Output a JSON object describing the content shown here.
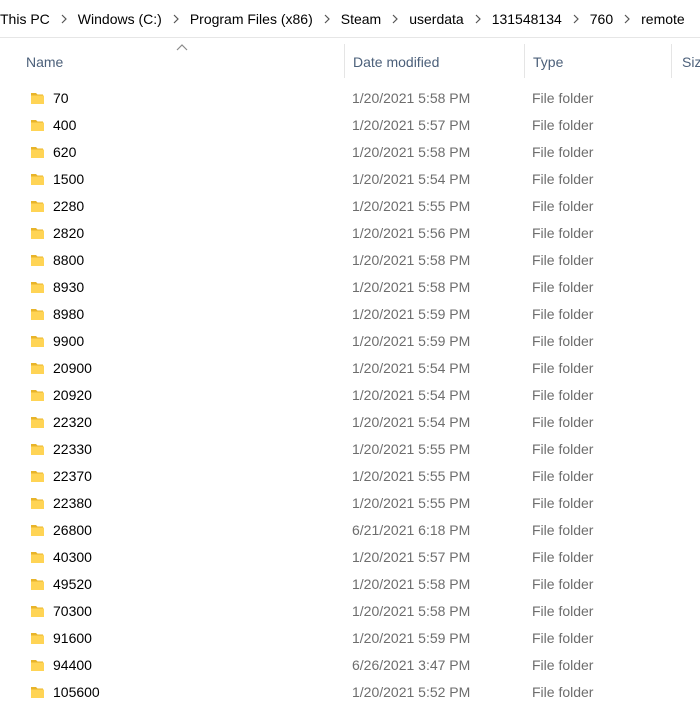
{
  "breadcrumb": [
    "This PC",
    "Windows (C:)",
    "Program Files (x86)",
    "Steam",
    "userdata",
    "131548134",
    "760",
    "remote"
  ],
  "columns": {
    "name": "Name",
    "date_modified": "Date modified",
    "type": "Type",
    "size": "Siz"
  },
  "sort": {
    "column": "name",
    "direction": "ascending"
  },
  "files": [
    {
      "name": "70",
      "date": "1/20/2021 5:58 PM",
      "type": "File folder"
    },
    {
      "name": "400",
      "date": "1/20/2021 5:57 PM",
      "type": "File folder"
    },
    {
      "name": "620",
      "date": "1/20/2021 5:58 PM",
      "type": "File folder"
    },
    {
      "name": "1500",
      "date": "1/20/2021 5:54 PM",
      "type": "File folder"
    },
    {
      "name": "2280",
      "date": "1/20/2021 5:55 PM",
      "type": "File folder"
    },
    {
      "name": "2820",
      "date": "1/20/2021 5:56 PM",
      "type": "File folder"
    },
    {
      "name": "8800",
      "date": "1/20/2021 5:58 PM",
      "type": "File folder"
    },
    {
      "name": "8930",
      "date": "1/20/2021 5:58 PM",
      "type": "File folder"
    },
    {
      "name": "8980",
      "date": "1/20/2021 5:59 PM",
      "type": "File folder"
    },
    {
      "name": "9900",
      "date": "1/20/2021 5:59 PM",
      "type": "File folder"
    },
    {
      "name": "20900",
      "date": "1/20/2021 5:54 PM",
      "type": "File folder"
    },
    {
      "name": "20920",
      "date": "1/20/2021 5:54 PM",
      "type": "File folder"
    },
    {
      "name": "22320",
      "date": "1/20/2021 5:54 PM",
      "type": "File folder"
    },
    {
      "name": "22330",
      "date": "1/20/2021 5:55 PM",
      "type": "File folder"
    },
    {
      "name": "22370",
      "date": "1/20/2021 5:55 PM",
      "type": "File folder"
    },
    {
      "name": "22380",
      "date": "1/20/2021 5:55 PM",
      "type": "File folder"
    },
    {
      "name": "26800",
      "date": "6/21/2021 6:18 PM",
      "type": "File folder"
    },
    {
      "name": "40300",
      "date": "1/20/2021 5:57 PM",
      "type": "File folder"
    },
    {
      "name": "49520",
      "date": "1/20/2021 5:58 PM",
      "type": "File folder"
    },
    {
      "name": "70300",
      "date": "1/20/2021 5:58 PM",
      "type": "File folder"
    },
    {
      "name": "91600",
      "date": "1/20/2021 5:59 PM",
      "type": "File folder"
    },
    {
      "name": "94400",
      "date": "6/26/2021 3:47 PM",
      "type": "File folder"
    },
    {
      "name": "105600",
      "date": "1/20/2021 5:52 PM",
      "type": "File folder"
    }
  ],
  "icons": {
    "folder": "folder-icon",
    "separator": "chevron-right-icon",
    "sort": "sort-ascending-icon"
  },
  "colors": {
    "folder_fill": "#ffd455",
    "folder_back": "#e8b42a",
    "header_text": "#4c607a",
    "secondary_text": "#6d6d6d"
  }
}
